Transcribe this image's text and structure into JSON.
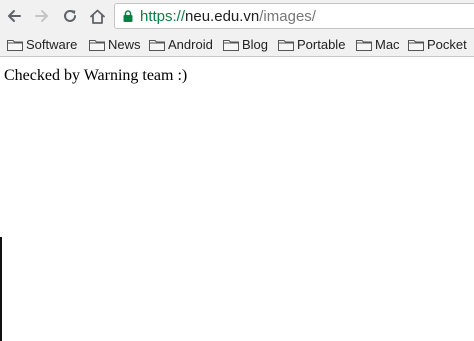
{
  "browser": {
    "url": {
      "scheme": "https://",
      "host": "neu.edu.vn",
      "path": "/images/"
    },
    "icons": {
      "back": "back-arrow-icon",
      "forward": "forward-arrow-icon",
      "reload": "reload-icon",
      "home": "home-icon",
      "lock": "lock-icon",
      "folder": "folder-icon"
    },
    "colors": {
      "secure_scheme": "#0b8043",
      "toolbar_bg": "#f1f1f1"
    }
  },
  "bookmarks": [
    {
      "label": "Software"
    },
    {
      "label": "News"
    },
    {
      "label": "Android"
    },
    {
      "label": "Blog"
    },
    {
      "label": "Portable"
    },
    {
      "label": "Mac"
    },
    {
      "label": "Pocket"
    }
  ],
  "page": {
    "text": "Checked by Warning team :)"
  }
}
